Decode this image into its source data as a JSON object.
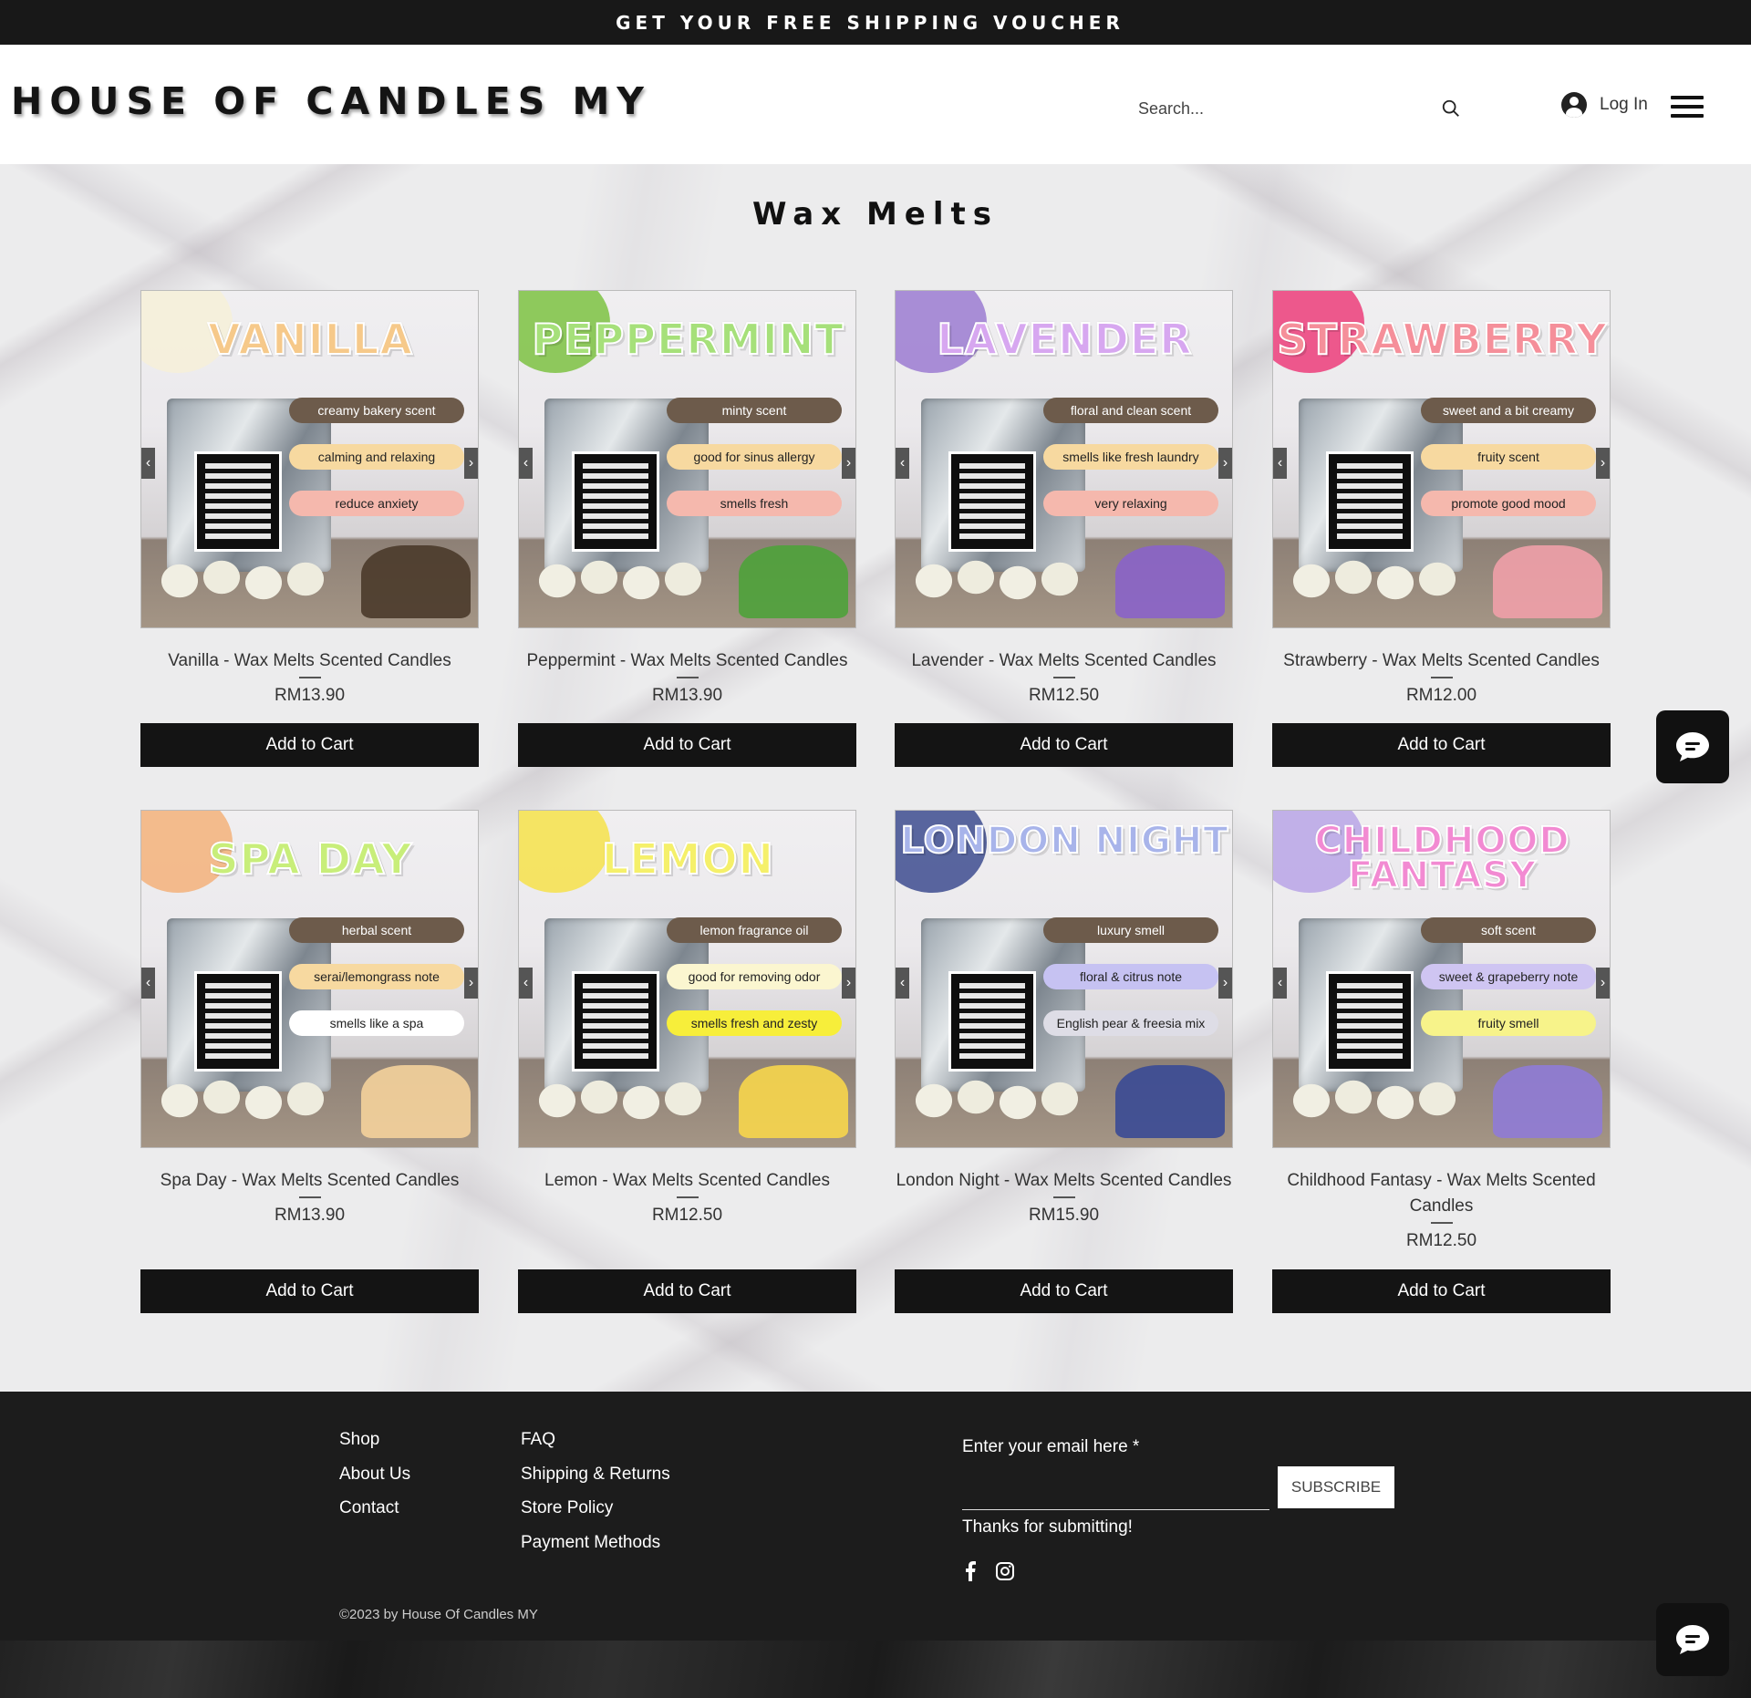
{
  "topbar": {
    "text": "GET YOUR FREE SHIPPING VOUCHER"
  },
  "header": {
    "logo": "HOUSE OF CANDLES MY",
    "search_placeholder": "Search...",
    "login_label": "Log In"
  },
  "page": {
    "title": "Wax Melts"
  },
  "products": [
    {
      "art_title": "VANILLA",
      "title_color": "#f6c98a",
      "deco_color": "#f6f0d8",
      "accent_color": "#4a3a2a",
      "tags": [
        "creamy bakery scent",
        "calming and relaxing",
        "reduce anxiety"
      ],
      "tag2_bg": "#f7d9a0",
      "tag3_bg": "#f5b8ad",
      "name": "Vanilla - Wax Melts Scented Candles",
      "price": "RM13.90",
      "cart": "Add to Cart"
    },
    {
      "art_title": "PEPPERMINT",
      "title_color": "#a6e07a",
      "deco_color": "#7cc242",
      "accent_color": "#4ea23a",
      "tags": [
        "minty scent",
        "good for sinus allergy",
        "smells fresh"
      ],
      "tag2_bg": "#f7d9a0",
      "tag3_bg": "#f5b8ad",
      "name": "Peppermint - Wax Melts Scented Candles",
      "price": "RM13.90",
      "cart": "Add to Cart"
    },
    {
      "art_title": "LAVENDER",
      "title_color": "#d7a7f0",
      "deco_color": "#9b7bd1",
      "accent_color": "#8a63c9",
      "tags": [
        "floral and clean scent",
        "smells like fresh laundry",
        "very relaxing"
      ],
      "tag2_bg": "#f7d9a0",
      "tag3_bg": "#f5b8ad",
      "name": "Lavender - Wax Melts Scented Candles",
      "price": "RM12.50",
      "cart": "Add to Cart"
    },
    {
      "art_title": "STRAWBERRY",
      "title_color": "#f58f9a",
      "deco_color": "#ec3d7a",
      "accent_color": "#f0a0a8",
      "tags": [
        "sweet and a bit creamy",
        "fruity scent",
        "promote good mood"
      ],
      "tag2_bg": "#f7d9a0",
      "tag3_bg": "#f5b8ad",
      "name": "Strawberry - Wax Melts Scented Candles",
      "price": "RM12.00",
      "cart": "Add to Cart"
    },
    {
      "art_title": "SPA DAY",
      "title_color": "#c8ee7a",
      "deco_color": "#f3b27a",
      "accent_color": "#f4d29b",
      "tags": [
        "herbal scent",
        "serai/lemongrass note",
        "smells like a spa"
      ],
      "tag2_bg": "#f7d9a0",
      "tag3_bg": "#ffffff",
      "name": "Spa Day - Wax Melts Scented Candles",
      "price": "RM13.90",
      "cart": "Add to Cart"
    },
    {
      "art_title": "LEMON",
      "title_color": "#f5f06a",
      "deco_color": "#f6e24a",
      "accent_color": "#f7d64b",
      "tags": [
        "lemon fragrance oil",
        "good for removing odor",
        "smells fresh and zesty"
      ],
      "tag2_bg": "#fbf6d0",
      "tag3_bg": "#f7ee3a",
      "name": "Lemon - Wax Melts Scented Candles",
      "price": "RM12.50",
      "cart": "Add to Cart"
    },
    {
      "art_title": "LONDON NIGHT",
      "title_color": "#a8b4ea",
      "deco_color": "#3d4c8f",
      "accent_color": "#3a4a95",
      "tags": [
        "luxury smell",
        "floral & citrus note",
        "English pear & freesia mix"
      ],
      "tag2_bg": "#c6c2f2",
      "tag3_bg": "#dedde6",
      "name": "London Night - Wax Melts Scented Candles",
      "price": "RM15.90",
      "cart": "Add to Cart"
    },
    {
      "art_title": "CHILDHOOD FANTASY",
      "title_color": "#f28ad2",
      "deco_color": "#b9a4e6",
      "accent_color": "#8f7bd6",
      "tags": [
        "soft scent",
        "sweet & grapeberry note",
        "fruity smell"
      ],
      "tag2_bg": "#cfc5f2",
      "tag3_bg": "#f7f38a",
      "name": "Childhood Fantasy - Wax Melts Scented Candles",
      "price": "RM12.50",
      "cart": "Add to Cart"
    }
  ],
  "footer": {
    "col1": [
      "Shop",
      "About Us",
      "Contact"
    ],
    "col2": [
      "FAQ",
      "Shipping & Returns",
      "Store Policy",
      "Payment Methods"
    ],
    "newsletter_label": "Enter your email here *",
    "subscribe": "SUBSCRIBE",
    "thanks": "Thanks for submitting!",
    "copyright": "©2023 by House Of Candles MY"
  },
  "icons": [
    "search-icon",
    "user-icon",
    "menu-icon",
    "chevron-left-icon",
    "chevron-right-icon",
    "facebook-icon",
    "instagram-icon",
    "chat-icon"
  ]
}
